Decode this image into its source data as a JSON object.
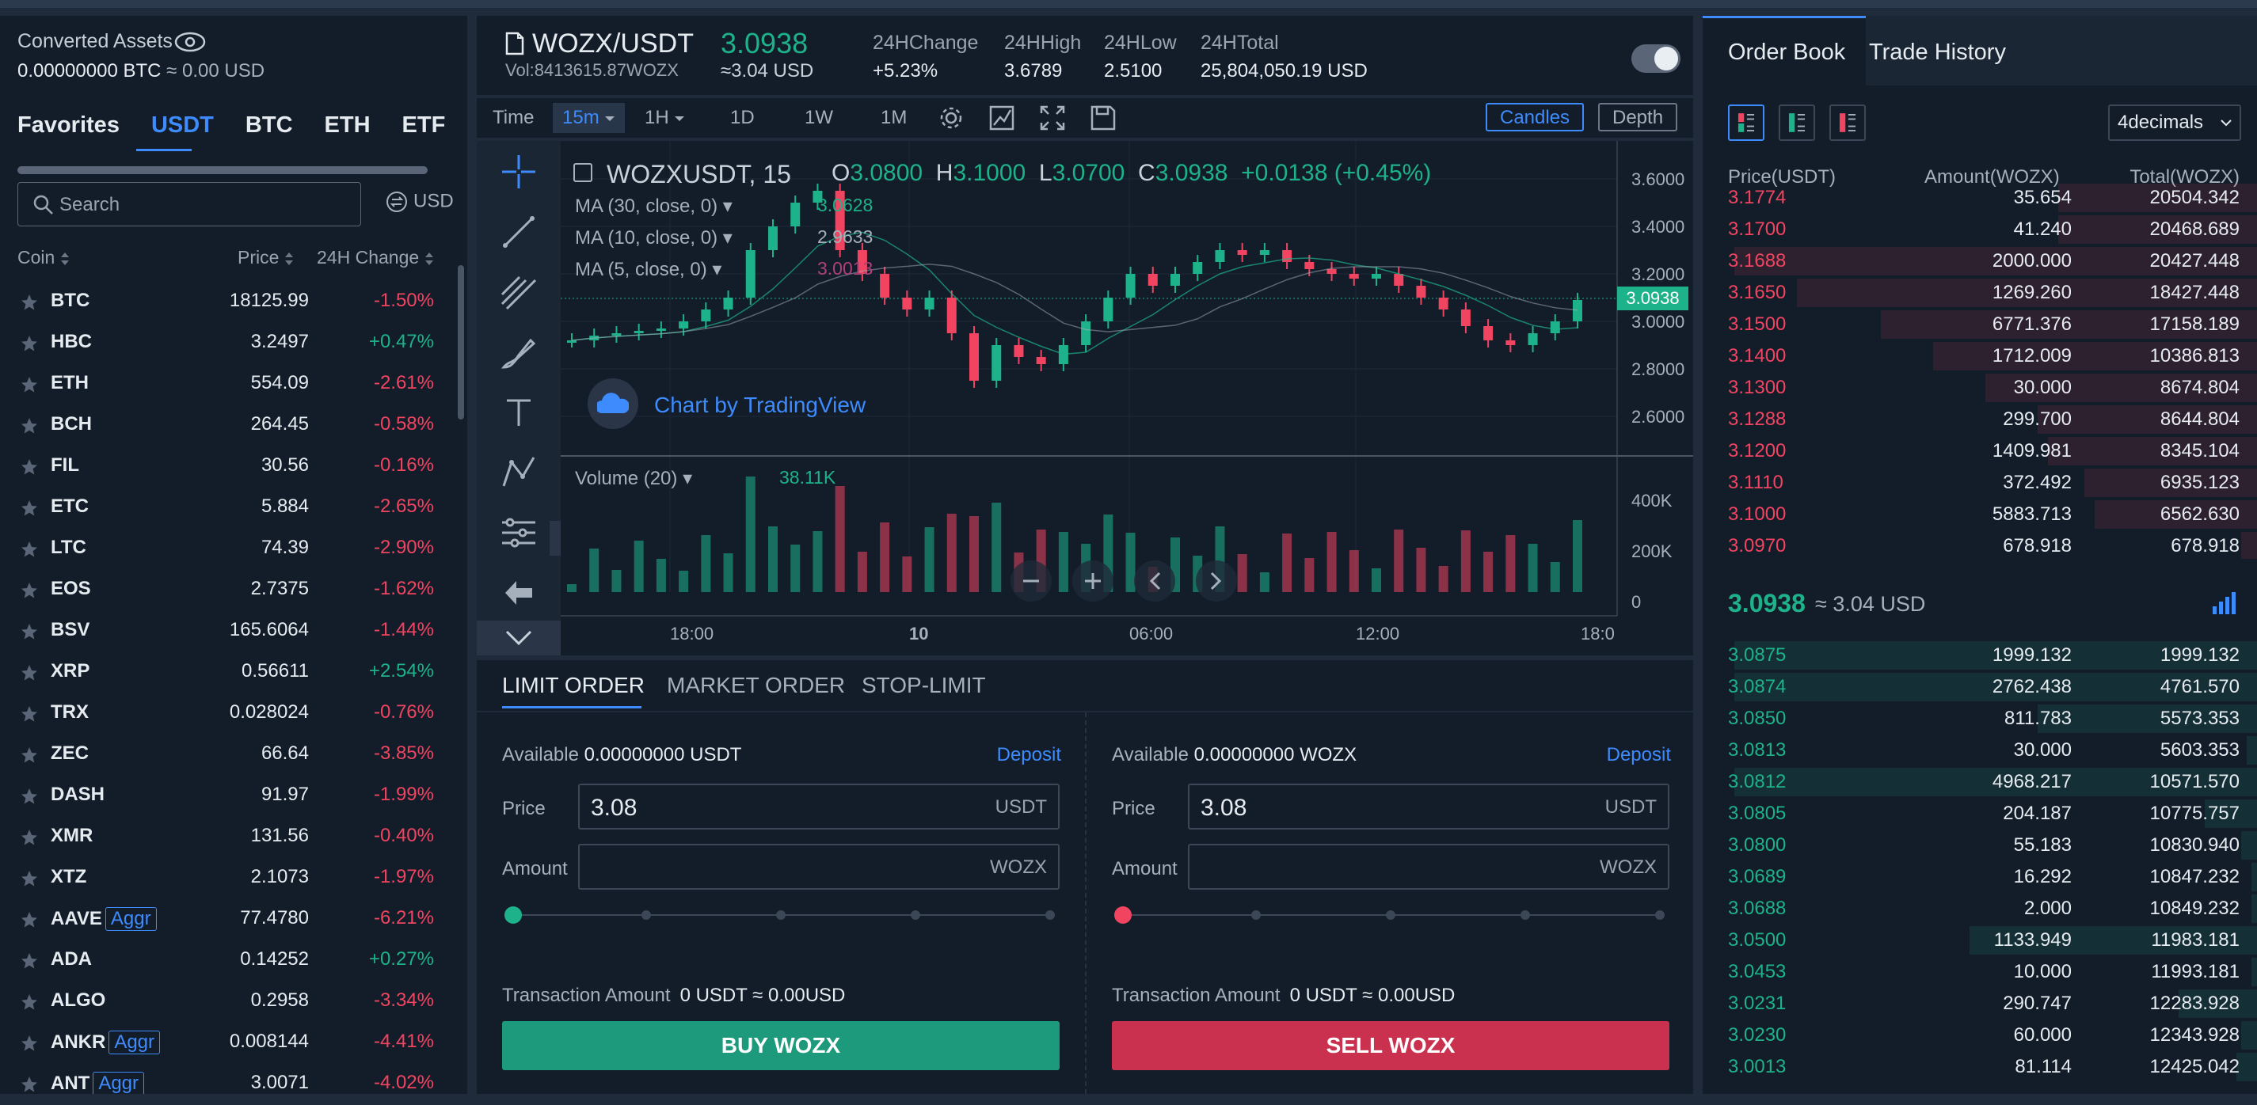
{
  "left": {
    "converted_label": "Converted Assets",
    "converted_value": "0.00000000 BTC",
    "converted_usd": "≈ 0.00 USD",
    "tabs": [
      "Favorites",
      "USDT",
      "BTC",
      "ETH",
      "ETF",
      "USD"
    ],
    "active_tab": "USDT",
    "search_placeholder": "Search",
    "currency_toggle": "USD",
    "col_coin": "Coin",
    "col_price": "Price",
    "col_change": "24H Change",
    "coins": [
      {
        "name": "BTC",
        "aggr": "",
        "price": "18125.99",
        "change": "-1.50%"
      },
      {
        "name": "HBC",
        "aggr": "",
        "price": "3.2497",
        "change": "+0.47%"
      },
      {
        "name": "ETH",
        "aggr": "",
        "price": "554.09",
        "change": "-2.61%"
      },
      {
        "name": "BCH",
        "aggr": "",
        "price": "264.45",
        "change": "-0.58%"
      },
      {
        "name": "FIL",
        "aggr": "",
        "price": "30.56",
        "change": "-0.16%"
      },
      {
        "name": "ETC",
        "aggr": "",
        "price": "5.884",
        "change": "-2.65%"
      },
      {
        "name": "LTC",
        "aggr": "",
        "price": "74.39",
        "change": "-2.90%"
      },
      {
        "name": "EOS",
        "aggr": "",
        "price": "2.7375",
        "change": "-1.62%"
      },
      {
        "name": "BSV",
        "aggr": "",
        "price": "165.6064",
        "change": "-1.44%"
      },
      {
        "name": "XRP",
        "aggr": "",
        "price": "0.56611",
        "change": "+2.54%"
      },
      {
        "name": "TRX",
        "aggr": "",
        "price": "0.028024",
        "change": "-0.76%"
      },
      {
        "name": "ZEC",
        "aggr": "",
        "price": "66.64",
        "change": "-3.85%"
      },
      {
        "name": "DASH",
        "aggr": "",
        "price": "91.97",
        "change": "-1.99%"
      },
      {
        "name": "XMR",
        "aggr": "",
        "price": "131.56",
        "change": "-0.40%"
      },
      {
        "name": "XTZ",
        "aggr": "",
        "price": "2.1073",
        "change": "-1.97%"
      },
      {
        "name": "AAVE",
        "aggr": "Aggr",
        "price": "77.4780",
        "change": "-6.21%"
      },
      {
        "name": "ADA",
        "aggr": "",
        "price": "0.14252",
        "change": "+0.27%"
      },
      {
        "name": "ALGO",
        "aggr": "",
        "price": "0.2958",
        "change": "-3.34%"
      },
      {
        "name": "ANKR",
        "aggr": "Aggr",
        "price": "0.008144",
        "change": "-4.41%"
      },
      {
        "name": "ANT",
        "aggr": "Aggr",
        "price": "3.0071",
        "change": "-4.02%"
      }
    ]
  },
  "ticker": {
    "pair": "WOZX/USDT",
    "last": "3.0938",
    "vol": "Vol:8413615.87WOZX",
    "last_usd": "≈3.04 USD",
    "change_label": "24HChange",
    "change_value": "+5.23%",
    "high_label": "24HHigh",
    "high_value": "3.6789",
    "low_label": "24HLow",
    "low_value": "2.5100",
    "total_label": "24HTotal",
    "total_value": "25,804,050.19 USD"
  },
  "toolbar": {
    "time_label": "Time",
    "intervals": [
      "15m",
      "1H",
      "1D",
      "1W",
      "1M"
    ],
    "active_interval": "15m",
    "candles_label": "Candles",
    "depth_label": "Depth"
  },
  "chart": {
    "symbol": "WOZXUSDT, 15",
    "o_label": "O",
    "o_value": "3.0800",
    "h_label": "H",
    "h_value": "3.1000",
    "l_label": "L",
    "l_value": "3.0700",
    "c_label": "C",
    "c_value": "3.0938",
    "change": "+0.0138 (+0.45%)",
    "ma": [
      {
        "label": "MA (30, close, 0)",
        "value": "3.0628",
        "color": "#1eb28a"
      },
      {
        "label": "MA (10, close, 0)",
        "value": "2.9633",
        "color": "#a6b0bc"
      },
      {
        "label": "MA (5, close, 0)",
        "value": "3.0013",
        "color": "#b0407a"
      }
    ],
    "tv_text": "Chart by TradingView",
    "volume_label": "Volume (20)",
    "volume_value": "38.11K",
    "price_ticks": [
      "3.6000",
      "3.4000",
      "3.2000",
      "3.0000",
      "2.8000",
      "2.6000"
    ],
    "volume_ticks": [
      "400K",
      "200K",
      "0"
    ],
    "time_ticks": [
      "18:00",
      "10",
      "06:00",
      "12:00",
      "18:0"
    ],
    "current_price_tag": "3.0938",
    "up_color": "#1eb28a",
    "down_color": "#f04460"
  },
  "order": {
    "tabs": [
      "LIMIT ORDER",
      "MARKET ORDER",
      "STOP-LIMIT"
    ],
    "active_tab": "LIMIT ORDER",
    "buy": {
      "available_label": "Available",
      "available_value": "0.00000000 USDT",
      "deposit": "Deposit",
      "price_label": "Price",
      "price_value": "3.08",
      "price_unit": "USDT",
      "amount_label": "Amount",
      "amount_value": "",
      "amount_unit": "WOZX",
      "tx_label": "Transaction Amount",
      "tx_value": "0 USDT ≈ 0.00USD",
      "button": "BUY WOZX"
    },
    "sell": {
      "available_label": "Available",
      "available_value": "0.00000000 WOZX",
      "deposit": "Deposit",
      "price_label": "Price",
      "price_value": "3.08",
      "price_unit": "USDT",
      "amount_label": "Amount",
      "amount_value": "",
      "amount_unit": "WOZX",
      "tx_label": "Transaction Amount",
      "tx_value": "0 USDT ≈ 0.00USD",
      "button": "SELL WOZX"
    }
  },
  "orderbook": {
    "tabs": [
      "Order Book",
      "Trade History"
    ],
    "active_tab": "Order Book",
    "decimals": "4decimals",
    "col_price": "Price(USDT)",
    "col_amount": "Amount(WOZX)",
    "col_total": "Total(WOZX)",
    "asks": [
      {
        "price": "3.1774",
        "amount": "35.654",
        "total": "20504.342",
        "depth": 0.38
      },
      {
        "price": "3.1700",
        "amount": "41.240",
        "total": "20468.689",
        "depth": 0.38
      },
      {
        "price": "3.1688",
        "amount": "2000.000",
        "total": "20427.448",
        "depth": 1.0
      },
      {
        "price": "3.1650",
        "amount": "1269.260",
        "total": "18427.448",
        "depth": 0.88
      },
      {
        "price": "3.1500",
        "amount": "6771.376",
        "total": "17158.189",
        "depth": 0.72
      },
      {
        "price": "3.1400",
        "amount": "1712.009",
        "total": "10386.813",
        "depth": 0.62
      },
      {
        "price": "3.1300",
        "amount": "30.000",
        "total": "8674.804",
        "depth": 0.52
      },
      {
        "price": "3.1288",
        "amount": "299.700",
        "total": "8644.804",
        "depth": 0.42
      },
      {
        "price": "3.1200",
        "amount": "1409.981",
        "total": "8345.104",
        "depth": 0.4
      },
      {
        "price": "3.1110",
        "amount": "372.492",
        "total": "6935.123",
        "depth": 0.33
      },
      {
        "price": "3.1000",
        "amount": "5883.713",
        "total": "6562.630",
        "depth": 0.31
      },
      {
        "price": "3.0970",
        "amount": "678.918",
        "total": "678.918",
        "depth": 0.03
      }
    ],
    "mid_price": "3.0938",
    "mid_usd": "≈ 3.04 USD",
    "bids": [
      {
        "price": "3.0875",
        "amount": "1999.132",
        "total": "1999.132",
        "depth": 1.0
      },
      {
        "price": "3.0874",
        "amount": "2762.438",
        "total": "4761.570",
        "depth": 1.0
      },
      {
        "price": "3.0850",
        "amount": "811.783",
        "total": "5573.353",
        "depth": 0.42
      },
      {
        "price": "3.0813",
        "amount": "30.000",
        "total": "5603.353",
        "depth": 0.02
      },
      {
        "price": "3.0812",
        "amount": "4968.217",
        "total": "10571.570",
        "depth": 1.0
      },
      {
        "price": "3.0805",
        "amount": "204.187",
        "total": "10775.757",
        "depth": 0.1
      },
      {
        "price": "3.0800",
        "amount": "55.183",
        "total": "10830.940",
        "depth": 0.03
      },
      {
        "price": "3.0689",
        "amount": "16.292",
        "total": "10847.232",
        "depth": 0.01
      },
      {
        "price": "3.0688",
        "amount": "2.000",
        "total": "10849.232",
        "depth": 0.01
      },
      {
        "price": "3.0500",
        "amount": "1133.949",
        "total": "11983.181",
        "depth": 0.55
      },
      {
        "price": "3.0453",
        "amount": "10.000",
        "total": "11993.181",
        "depth": 0.01
      },
      {
        "price": "3.0231",
        "amount": "290.747",
        "total": "12283.928",
        "depth": 0.15
      },
      {
        "price": "3.0230",
        "amount": "60.000",
        "total": "12343.928",
        "depth": 0.03
      },
      {
        "price": "3.0013",
        "amount": "81.114",
        "total": "12425.042",
        "depth": 0.04
      }
    ]
  }
}
